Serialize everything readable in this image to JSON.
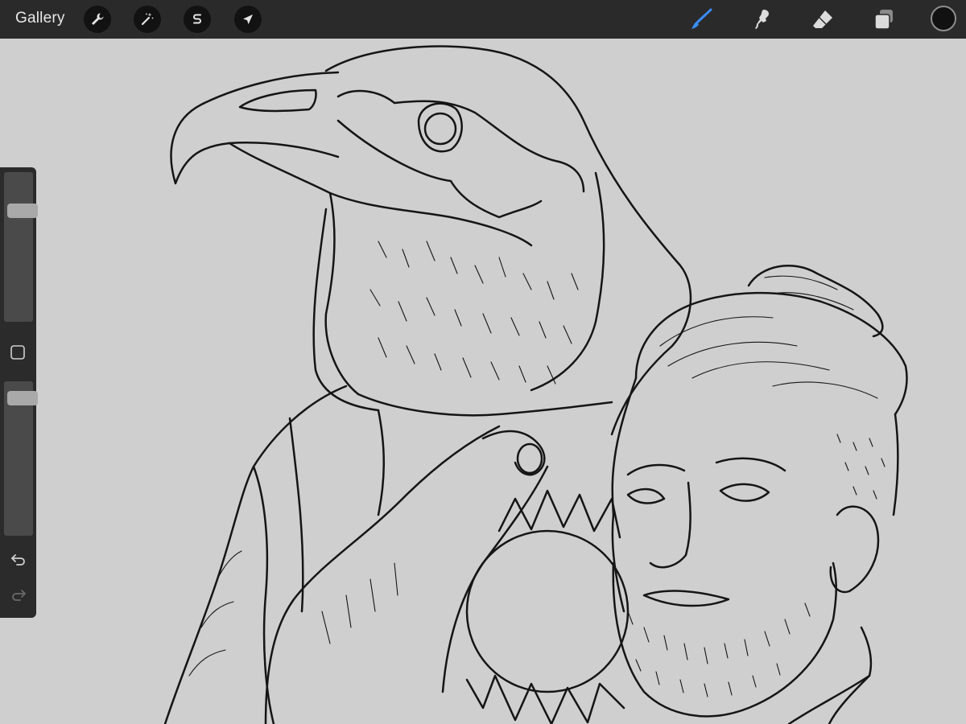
{
  "toolbar": {
    "gallery_label": "Gallery",
    "left_tools": [
      {
        "name": "actions",
        "icon": "wrench-icon"
      },
      {
        "name": "adjustments",
        "icon": "magic-wand-icon"
      },
      {
        "name": "selection",
        "icon": "selection-s-icon"
      },
      {
        "name": "transform",
        "icon": "arrow-cursor-icon"
      }
    ],
    "right_tools": [
      {
        "name": "brush",
        "icon": "brush-icon",
        "active": true
      },
      {
        "name": "smudge",
        "icon": "smudge-finger-icon"
      },
      {
        "name": "eraser",
        "icon": "eraser-icon"
      },
      {
        "name": "layers",
        "icon": "layers-icon"
      }
    ],
    "current_color": "#111111",
    "active_color": "#3a8cff"
  },
  "sidebar": {
    "brush_size_level": 0.77,
    "opacity_level": 0.93,
    "modifier_icon": "square-icon",
    "undo_icon": "undo-icon",
    "redo_icon": "redo-icon"
  },
  "canvas": {
    "background": "#cfcfcf",
    "line_color": "#151515"
  }
}
